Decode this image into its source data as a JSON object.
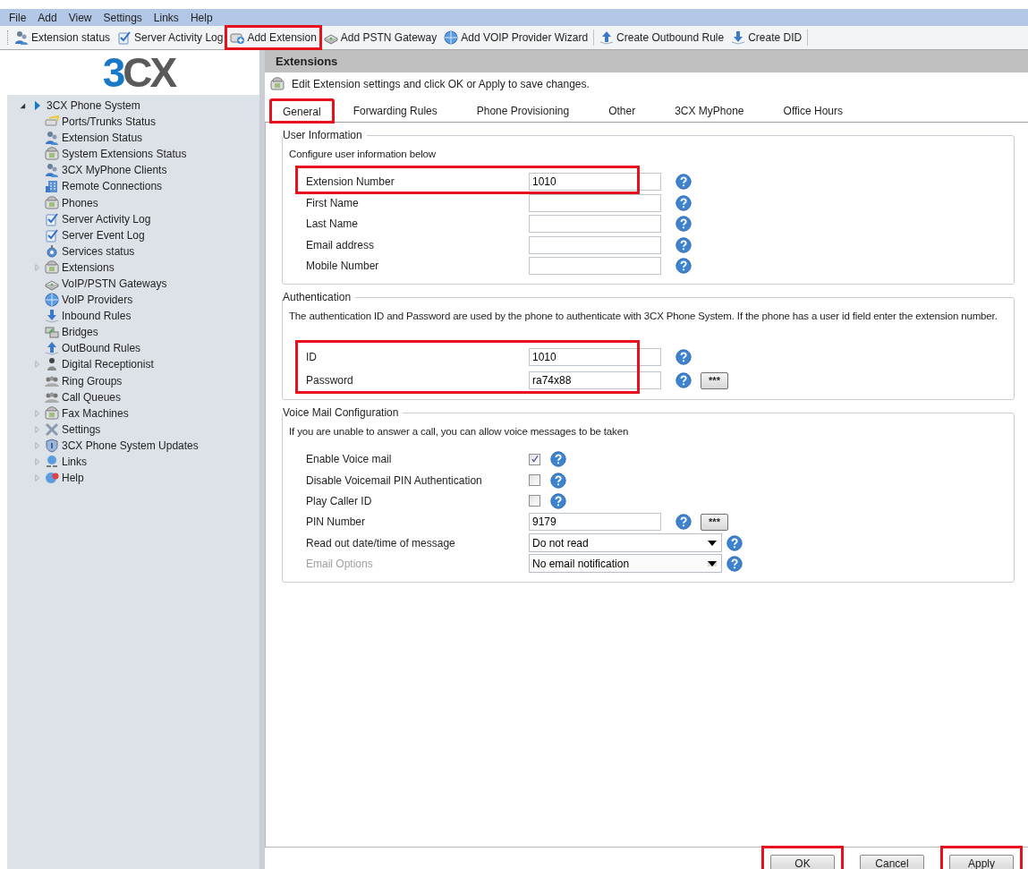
{
  "menu": [
    "File",
    "Add",
    "View",
    "Settings",
    "Links",
    "Help"
  ],
  "toolbar": [
    {
      "label": "Extension status",
      "highlighted": false
    },
    {
      "label": "Server Activity Log",
      "highlighted": false
    },
    {
      "label": "Add Extension",
      "highlighted": true
    },
    {
      "label": "Add PSTN Gateway",
      "highlighted": false
    },
    {
      "label": "Add VOIP Provider Wizard",
      "highlighted": false
    },
    {
      "label": "Create Outbound Rule",
      "highlighted": false
    },
    {
      "label": "Create DID",
      "highlighted": false
    }
  ],
  "logo": "3CX",
  "tree": {
    "label": "3CX Phone System",
    "expanded": true,
    "children": [
      {
        "label": "Ports/Trunks Status",
        "kind": "item"
      },
      {
        "label": "Extension Status",
        "kind": "item"
      },
      {
        "label": "System Extensions Status",
        "kind": "item"
      },
      {
        "label": "3CX MyPhone Clients",
        "kind": "item"
      },
      {
        "label": "Remote Connections",
        "kind": "item"
      },
      {
        "label": "Phones",
        "kind": "item"
      },
      {
        "label": "Server Activity Log",
        "kind": "item"
      },
      {
        "label": "Server Event Log",
        "kind": "item"
      },
      {
        "label": "Services status",
        "kind": "item"
      },
      {
        "label": "Extensions",
        "kind": "group",
        "expanded": false
      },
      {
        "label": "VoIP/PSTN Gateways",
        "kind": "item"
      },
      {
        "label": "VoIP Providers",
        "kind": "item"
      },
      {
        "label": "Inbound Rules",
        "kind": "item"
      },
      {
        "label": "Bridges",
        "kind": "item"
      },
      {
        "label": "OutBound Rules",
        "kind": "item"
      },
      {
        "label": "Digital Receptionist",
        "kind": "group",
        "expanded": false
      },
      {
        "label": "Ring Groups",
        "kind": "item"
      },
      {
        "label": "Call Queues",
        "kind": "item"
      },
      {
        "label": "Fax Machines",
        "kind": "group",
        "expanded": false
      },
      {
        "label": "Settings",
        "kind": "group",
        "expanded": false
      },
      {
        "label": "3CX Phone System Updates",
        "kind": "group",
        "expanded": false
      },
      {
        "label": "Links",
        "kind": "group",
        "expanded": false
      },
      {
        "label": "Help",
        "kind": "group",
        "expanded": false
      }
    ]
  },
  "panel": {
    "title": "Extensions",
    "description": "Edit Extension settings and click OK or Apply to save changes.",
    "tabs": [
      {
        "label": "General",
        "selected": true,
        "highlighted": true
      },
      {
        "label": "Forwarding Rules",
        "selected": false,
        "highlighted": false
      },
      {
        "label": "Phone Provisioning",
        "selected": false,
        "highlighted": false
      },
      {
        "label": "Other",
        "selected": false,
        "highlighted": false
      },
      {
        "label": "3CX MyPhone",
        "selected": false,
        "highlighted": false
      },
      {
        "label": "Office Hours",
        "selected": false,
        "highlighted": false
      }
    ],
    "sections": [
      {
        "legend": "User Information",
        "intro": "Configure user information below",
        "rows": [
          {
            "kind": "text",
            "label": "Extension Number",
            "value": "1010",
            "highlighted": true
          },
          {
            "kind": "text",
            "label": "First Name",
            "highlighted": false
          },
          {
            "kind": "text",
            "label": "Last Name",
            "highlighted": false
          },
          {
            "kind": "text",
            "label": "Email address",
            "highlighted": false
          },
          {
            "kind": "text",
            "label": "Mobile Number",
            "highlighted": false
          }
        ]
      },
      {
        "legend": "Authentication",
        "intro": "The authentication ID and Password are used by the phone to authenticate with 3CX Phone System. If the phone has a user id field enter the extension number.",
        "rows": [
          {
            "kind": "text",
            "label": "ID",
            "value": "1010",
            "highlighted": true
          },
          {
            "kind": "text",
            "label": "Password",
            "value": "ra74x88",
            "highlighted": true,
            "reveal_button": "***"
          }
        ]
      },
      {
        "legend": "Voice Mail Configuration",
        "intro": "If you are unable to answer a call, you can allow voice messages to be taken",
        "rows": [
          {
            "kind": "checkbox",
            "label": "Enable Voice mail",
            "checked": true,
            "highlighted": false
          },
          {
            "kind": "checkbox",
            "label": "Disable Voicemail PIN Authentication",
            "checked": false,
            "highlighted": false
          },
          {
            "kind": "checkbox",
            "label": "Play Caller ID",
            "checked": false,
            "highlighted": false
          },
          {
            "kind": "text",
            "label": "PIN Number",
            "value": "9179",
            "highlighted": false,
            "reveal_button": "***"
          },
          {
            "kind": "select",
            "label": "Read out date/time of message",
            "value": "Do not read",
            "disabled": false,
            "highlighted": false
          },
          {
            "kind": "select",
            "label": "Email Options",
            "value": "No email notification",
            "disabled": true,
            "highlighted": false
          }
        ]
      }
    ]
  },
  "buttons": [
    {
      "label": "OK",
      "highlighted": true
    },
    {
      "label": "Cancel",
      "highlighted": false
    },
    {
      "label": "Apply",
      "highlighted": true
    }
  ]
}
